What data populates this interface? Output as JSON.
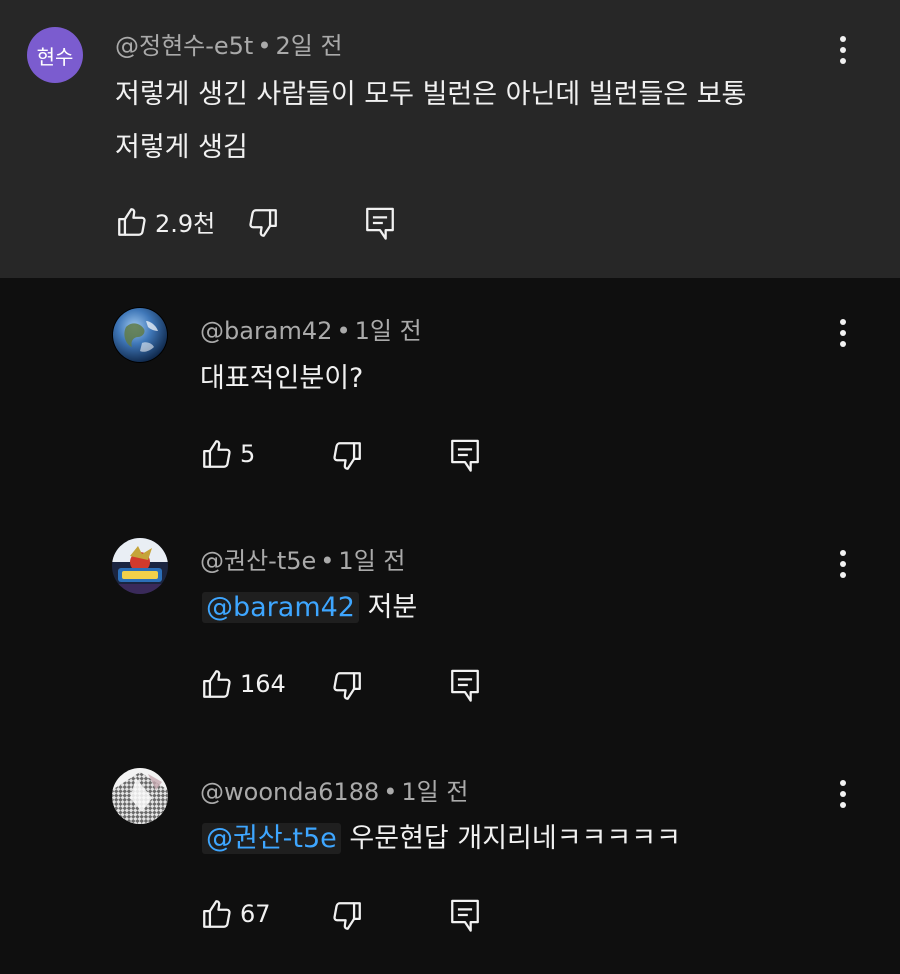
{
  "top_comment": {
    "avatar_text": "현수",
    "author": "@정현수-e5t",
    "time": "2일 전",
    "line1": "저렇게 생긴 사람들이 모두 빌런은 아닌데 빌런들은 보통",
    "line2": "저렇게 생김",
    "likes": "2.9천"
  },
  "replies": [
    {
      "author": "@baram42",
      "time": "1일 전",
      "mention": "",
      "text": "대표적인분이?",
      "likes": "5"
    },
    {
      "author": "@권산-t5e",
      "time": "1일 전",
      "mention": "@baram42",
      "text": "저분",
      "likes": "164"
    },
    {
      "author": "@woonda6188",
      "time": "1일 전",
      "mention": "@권산-t5e",
      "text": "우문현답 개지리네ㅋㅋㅋㅋㅋ",
      "likes": "67"
    }
  ],
  "separator": "•",
  "icons": {
    "like": "thumbs-up-icon",
    "dislike": "thumbs-down-icon",
    "reply": "reply-comment-icon",
    "more": "more-vertical-icon"
  },
  "colors": {
    "background": "#0f0f0f",
    "highlight_background": "#272727",
    "mention": "#3ea6ff",
    "avatar_purple": "#7b5ccf",
    "meta_text": "#aaaaaa"
  }
}
